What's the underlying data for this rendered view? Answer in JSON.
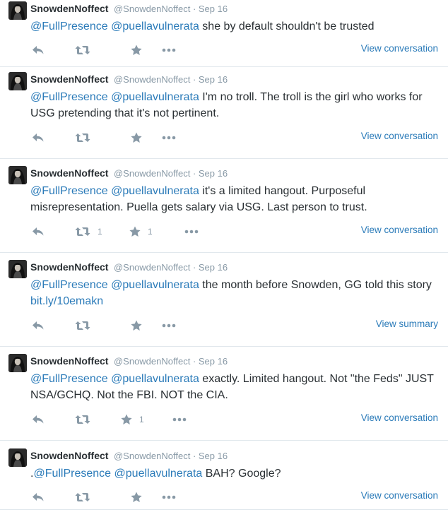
{
  "tweets": [
    {
      "fullname": "SnowdenNoffect",
      "handle": "@SnowdenNoffect",
      "date": "Sep 16",
      "prefix": "",
      "mentions": [
        "@FullPresence",
        "@puellavulnerata"
      ],
      "text": "she by default shouldn't be trusted",
      "link": "",
      "retweet_count": "",
      "favorite_count": "",
      "view_link": "View conversation"
    },
    {
      "fullname": "SnowdenNoffect",
      "handle": "@SnowdenNoffect",
      "date": "Sep 16",
      "prefix": "",
      "mentions": [
        "@FullPresence",
        "@puellavulnerata"
      ],
      "text": "I'm no troll. The troll is the girl who works for USG pretending that it's not pertinent.",
      "link": "",
      "retweet_count": "",
      "favorite_count": "",
      "view_link": "View conversation"
    },
    {
      "fullname": "SnowdenNoffect",
      "handle": "@SnowdenNoffect",
      "date": "Sep 16",
      "prefix": "",
      "mentions": [
        "@FullPresence",
        "@puellavulnerata"
      ],
      "text": "it's a limited hangout. Purposeful misrepresentation. Puella gets salary via USG. Last person to trust.",
      "link": "",
      "retweet_count": "1",
      "favorite_count": "1",
      "view_link": "View conversation"
    },
    {
      "fullname": "SnowdenNoffect",
      "handle": "@SnowdenNoffect",
      "date": "Sep 16",
      "prefix": "",
      "mentions": [
        "@FullPresence",
        "@puellavulnerata"
      ],
      "text": "the month before Snowden, GG told this story",
      "link": "bit.ly/10emakn",
      "retweet_count": "",
      "favorite_count": "",
      "view_link": "View summary"
    },
    {
      "fullname": "SnowdenNoffect",
      "handle": "@SnowdenNoffect",
      "date": "Sep 16",
      "prefix": "",
      "mentions": [
        "@FullPresence",
        "@puellavulnerata"
      ],
      "text": "exactly. Limited hangout. Not \"the Feds\" JUST NSA/GCHQ. Not the FBI. NOT the CIA.",
      "link": "",
      "retweet_count": "",
      "favorite_count": "1",
      "view_link": "View conversation"
    },
    {
      "fullname": "SnowdenNoffect",
      "handle": "@SnowdenNoffect",
      "date": "Sep 16",
      "prefix": ".",
      "mentions": [
        "@FullPresence",
        "@puellavulnerata"
      ],
      "text": "BAH? Google?",
      "link": "",
      "retweet_count": "",
      "favorite_count": "",
      "view_link": "View conversation"
    }
  ],
  "icons": {
    "reply": "reply-icon",
    "retweet": "retweet-icon",
    "favorite": "star-icon",
    "more": "more-icon",
    "avatar": "avatar"
  },
  "colors": {
    "link": "#2b7bb9",
    "muted": "#8899a6",
    "text": "#292f33",
    "divider": "#e1e8ed"
  }
}
